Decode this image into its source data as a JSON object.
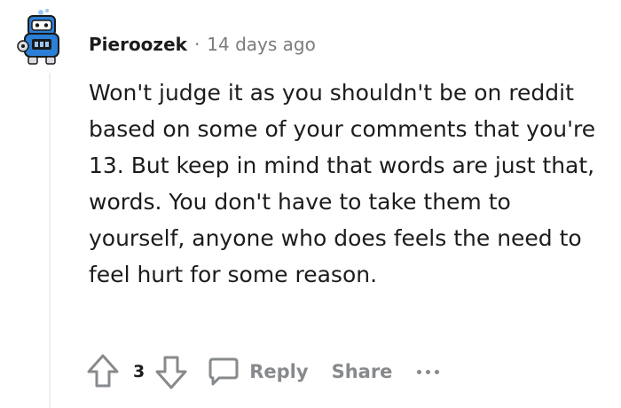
{
  "comment": {
    "author": "Pieroozek",
    "separator": "·",
    "time": "14 days ago",
    "body": "Won't judge it as you shouldn't be on reddit based on some of your comments that you're 13. But keep in mind that words are just that, words. You don't have to take them to yourself, anyone who does feels the need to feel hurt for some reason.",
    "score": "3"
  },
  "actions": {
    "reply_label": "Reply",
    "share_label": "Share"
  },
  "icons": {
    "upvote": "upvote-arrow-icon",
    "downvote": "downvote-arrow-icon",
    "reply": "speech-bubble-icon",
    "more": "ellipsis-icon"
  },
  "colors": {
    "text": "#1c1c1c",
    "muted": "#878a8c",
    "avatar_blue": "#2b7fd6"
  }
}
